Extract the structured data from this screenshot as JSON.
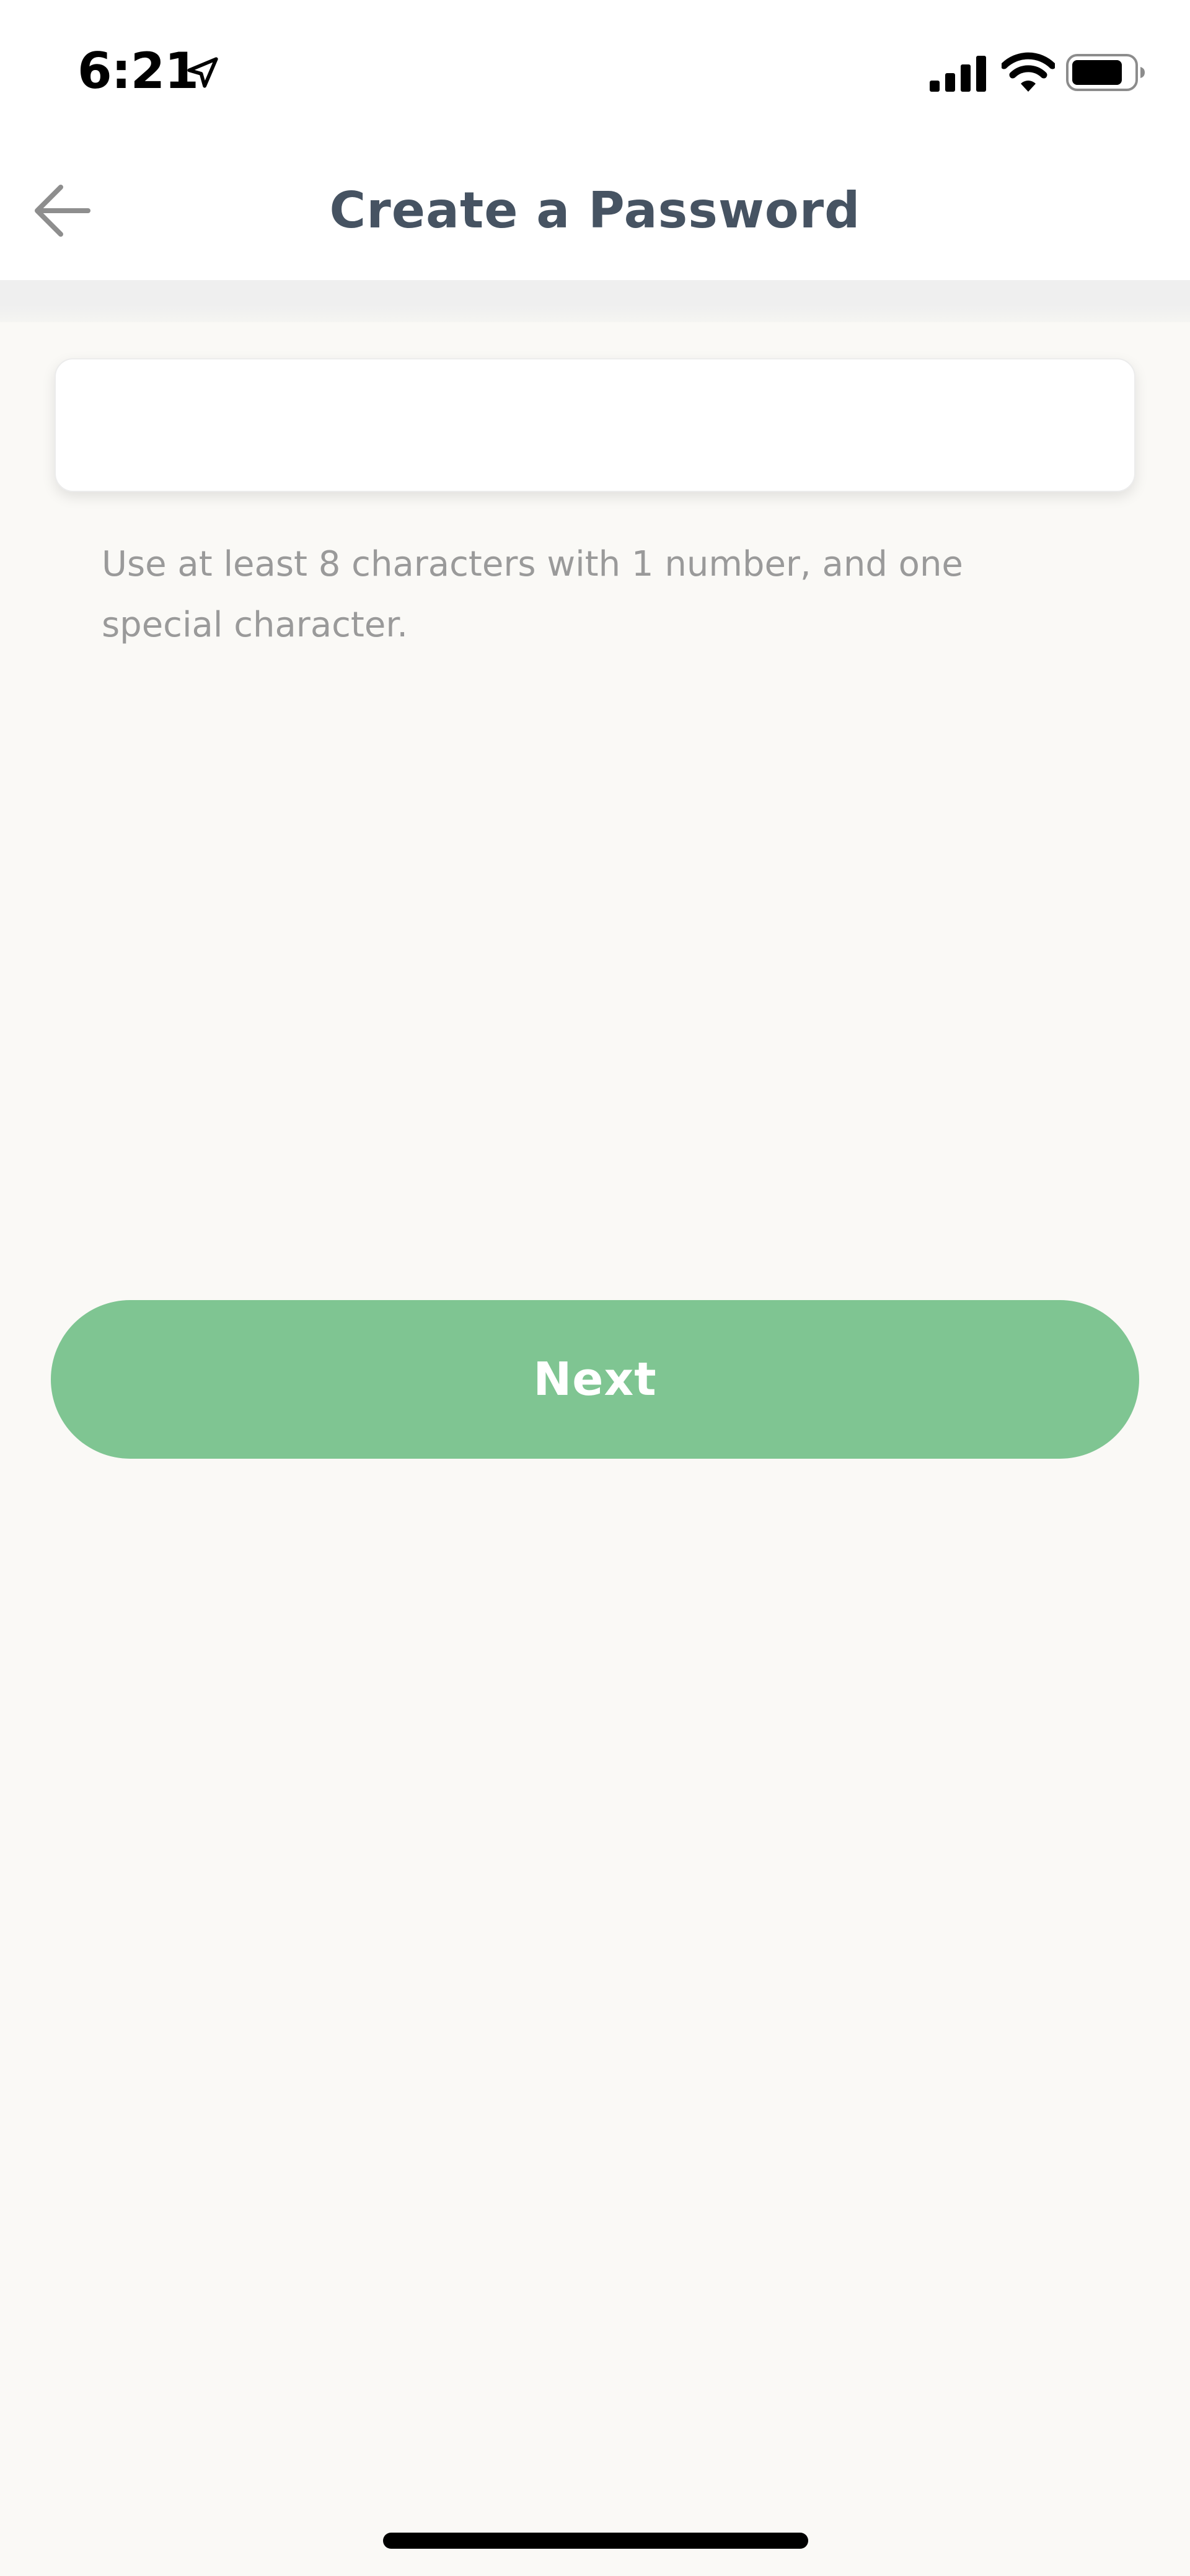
{
  "status_bar": {
    "time": "6:21",
    "icons": [
      "location-arrow-icon",
      "cellular-signal-icon",
      "wifi-icon",
      "battery-icon"
    ]
  },
  "header": {
    "title": "Create a Password",
    "back_icon": "back-arrow-icon"
  },
  "form": {
    "password_value": "",
    "password_placeholder": "",
    "hint": "Use at least 8 characters with 1 number, and one special character."
  },
  "actions": {
    "next_label": "Next"
  },
  "colors": {
    "primary_button": "#7fc592",
    "title_text": "#465362",
    "hint_text": "#9a9a9a",
    "background": "#faf9f6"
  }
}
